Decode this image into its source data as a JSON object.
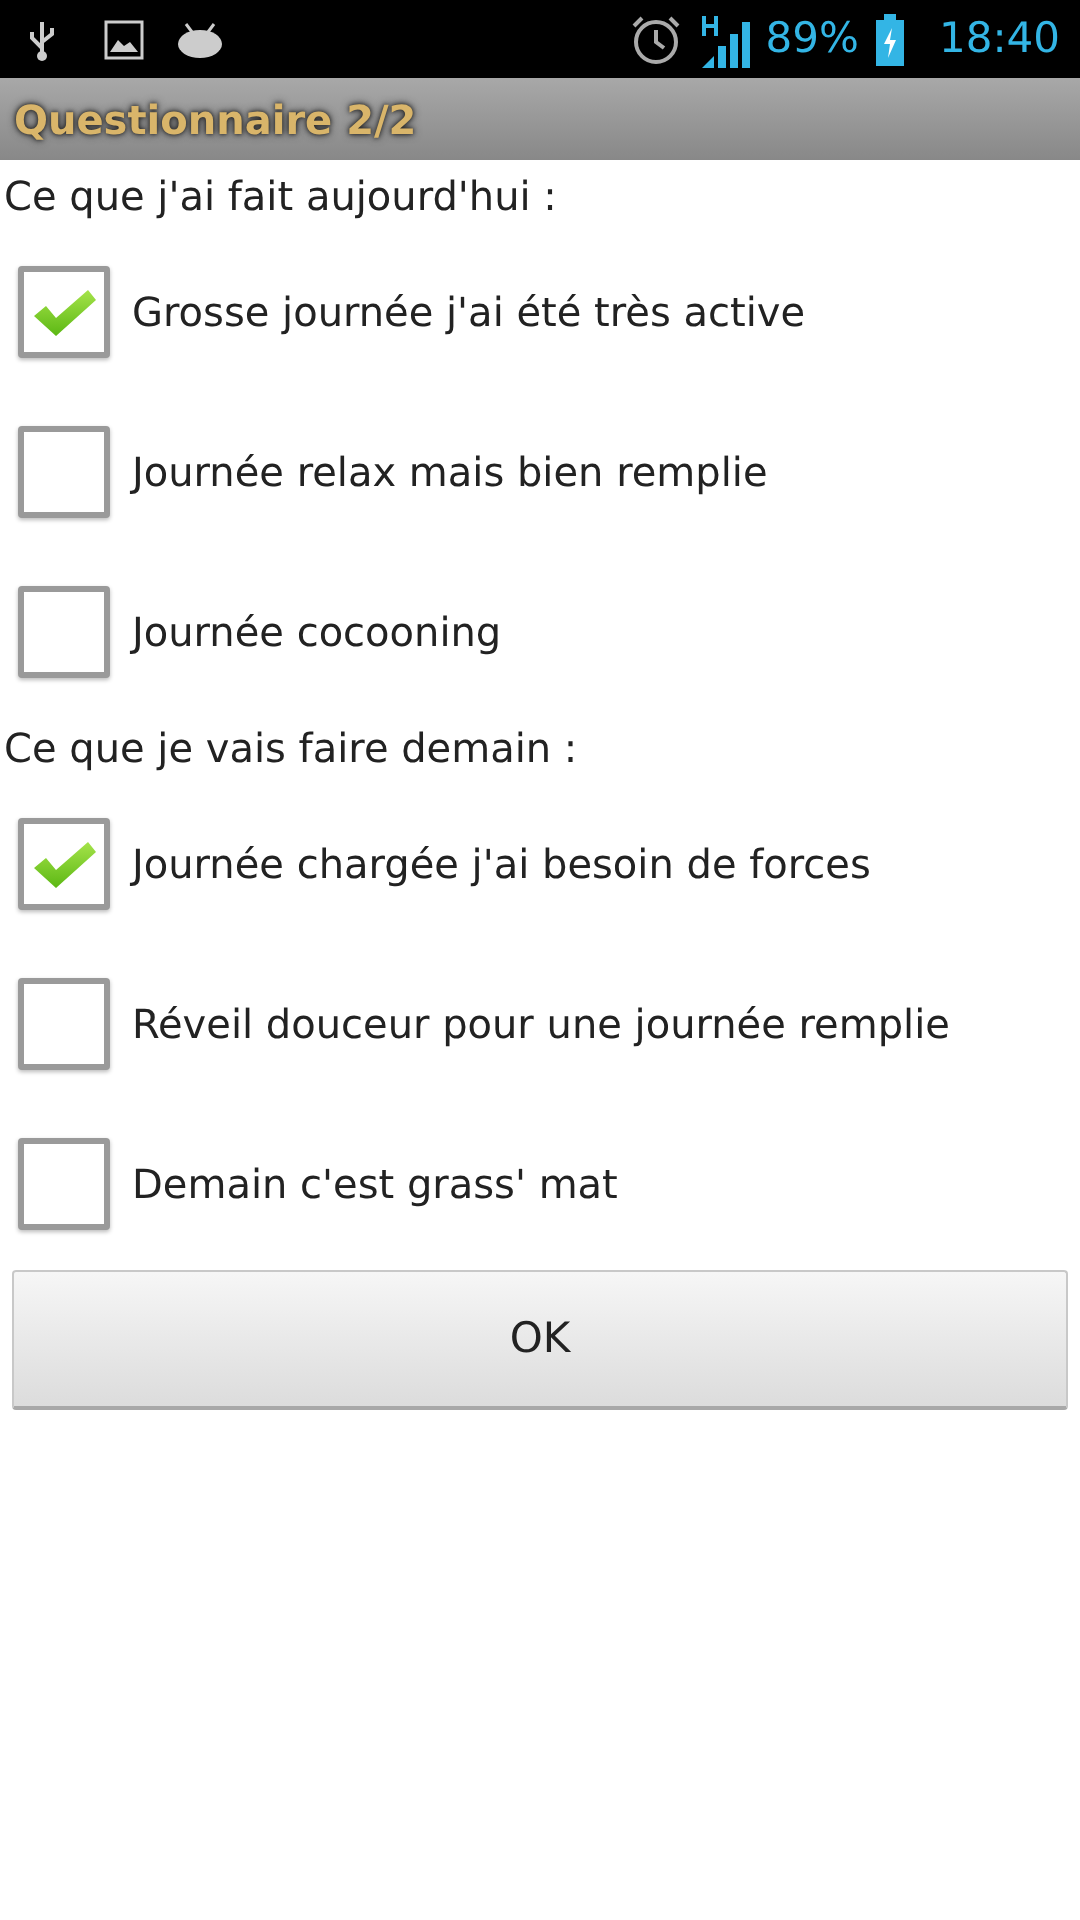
{
  "status_bar": {
    "battery": "89%",
    "time": "18:40"
  },
  "title": "Questionnaire 2/2",
  "sections": [
    {
      "label": "Ce que j'ai fait aujourd'hui :",
      "options": [
        {
          "label": "Grosse journée j'ai été très active",
          "checked": true
        },
        {
          "label": "Journée relax mais bien remplie",
          "checked": false
        },
        {
          "label": "Journée cocooning",
          "checked": false
        }
      ]
    },
    {
      "label": "Ce que je vais faire demain :",
      "options": [
        {
          "label": "Journée chargée j'ai besoin de forces",
          "checked": true
        },
        {
          "label": "Réveil douceur pour une journée remplie",
          "checked": false
        },
        {
          "label": "Demain c'est grass' mat",
          "checked": false
        }
      ]
    }
  ],
  "button": "OK"
}
